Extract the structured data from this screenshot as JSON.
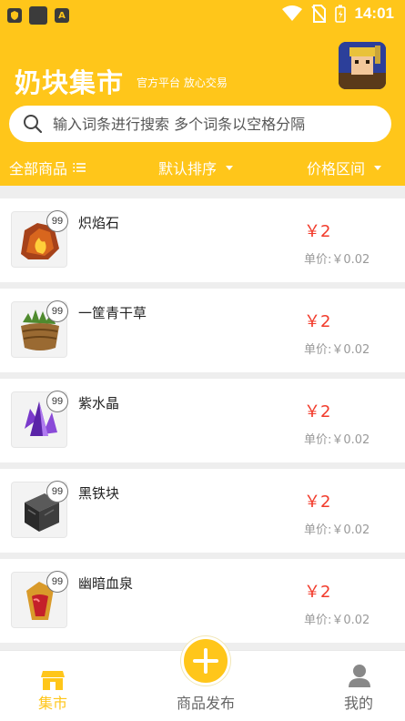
{
  "statusbar": {
    "time": "14:01",
    "left_icons": [
      "shield-icon",
      "app-icon",
      "a-icon"
    ],
    "right_icons": [
      "wifi-icon",
      "no-sim-icon",
      "battery-icon"
    ]
  },
  "header": {
    "title": "奶块集市",
    "subtitle": "官方平台 放心交易",
    "search_placeholder": "输入词条进行搜索 多个词条以空格分隔",
    "accent": "#ffc61a"
  },
  "filters": {
    "all_label": "全部商品",
    "sort_label": "默认排序",
    "price_label": "价格区间"
  },
  "items": [
    {
      "name": "炽焰石",
      "qty": "99",
      "price": "￥2",
      "unit": "单价:￥0.02",
      "icon": "fire-ore-icon"
    },
    {
      "name": "一筐青干草",
      "qty": "99",
      "price": "￥2",
      "unit": "单价:￥0.02",
      "icon": "hay-basket-icon"
    },
    {
      "name": "紫水晶",
      "qty": "99",
      "price": "￥2",
      "unit": "单价:￥0.02",
      "icon": "amethyst-icon"
    },
    {
      "name": "黑铁块",
      "qty": "99",
      "price": "￥2",
      "unit": "单价:￥0.02",
      "icon": "black-iron-block-icon"
    },
    {
      "name": "幽暗血泉",
      "qty": "99",
      "price": "￥2",
      "unit": "单价:￥0.02",
      "icon": "blood-spring-icon"
    }
  ],
  "tabbar": {
    "market_label": "集市",
    "publish_label": "商品发布",
    "mine_label": "我的",
    "active_color": "#ffc61a"
  }
}
